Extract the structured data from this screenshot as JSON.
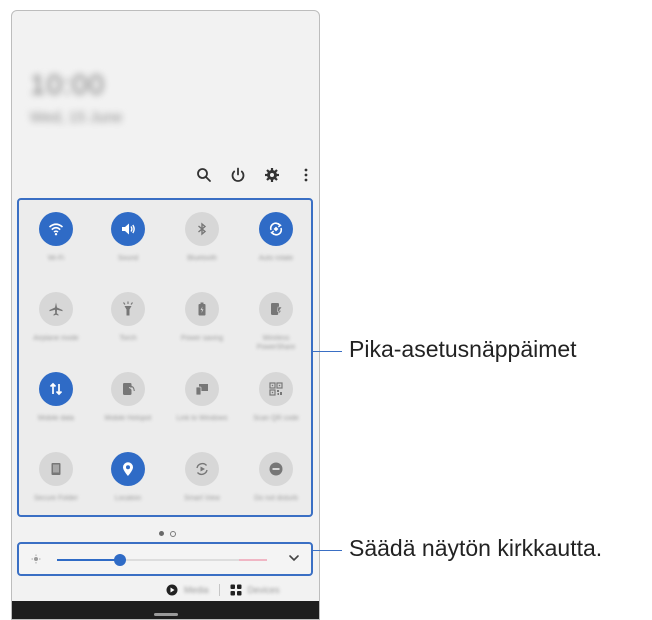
{
  "lock": {
    "time": "10:00",
    "date": "Wed, 15 June"
  },
  "top_icons": [
    "search-icon",
    "power-icon",
    "settings-gear-icon",
    "more-vertical-icon"
  ],
  "colors": {
    "accent": "#2f6bc6",
    "callout": "#3a6fc4"
  },
  "tiles": [
    {
      "label": "Wi-Fi",
      "icon": "wifi-icon",
      "on": true
    },
    {
      "label": "Sound",
      "icon": "sound-icon",
      "on": true
    },
    {
      "label": "Bluetooth",
      "icon": "bluetooth-icon",
      "on": false
    },
    {
      "label": "Auto rotate",
      "icon": "auto-rotate-icon",
      "on": true
    },
    {
      "label": "Airplane mode",
      "icon": "airplane-icon",
      "on": false
    },
    {
      "label": "Torch",
      "icon": "flashlight-icon",
      "on": false
    },
    {
      "label": "Power saving",
      "icon": "battery-icon",
      "on": false
    },
    {
      "label": "Wireless PowerShare",
      "icon": "powershare-icon",
      "on": false
    },
    {
      "label": "Mobile data",
      "icon": "mobile-data-icon",
      "on": true
    },
    {
      "label": "Mobile Hotspot",
      "icon": "hotspot-icon",
      "on": false
    },
    {
      "label": "Link to Windows",
      "icon": "link-windows-icon",
      "on": false
    },
    {
      "label": "Scan QR code",
      "icon": "qr-code-icon",
      "on": false
    },
    {
      "label": "Secure Folder",
      "icon": "secure-folder-icon",
      "on": false
    },
    {
      "label": "Location",
      "icon": "location-icon",
      "on": true
    },
    {
      "label": "Smart View",
      "icon": "smart-view-icon",
      "on": false
    },
    {
      "label": "Do not disturb",
      "icon": "do-not-disturb-icon",
      "on": false
    }
  ],
  "pages": {
    "count": 2,
    "current": 1
  },
  "brightness": {
    "level": 0.3
  },
  "bottom": {
    "media": "Media",
    "devices": "Devices"
  },
  "callouts": {
    "quick_settings": "Pika-asetusnäppäimet",
    "brightness": "Säädä näytön kirkkautta."
  }
}
